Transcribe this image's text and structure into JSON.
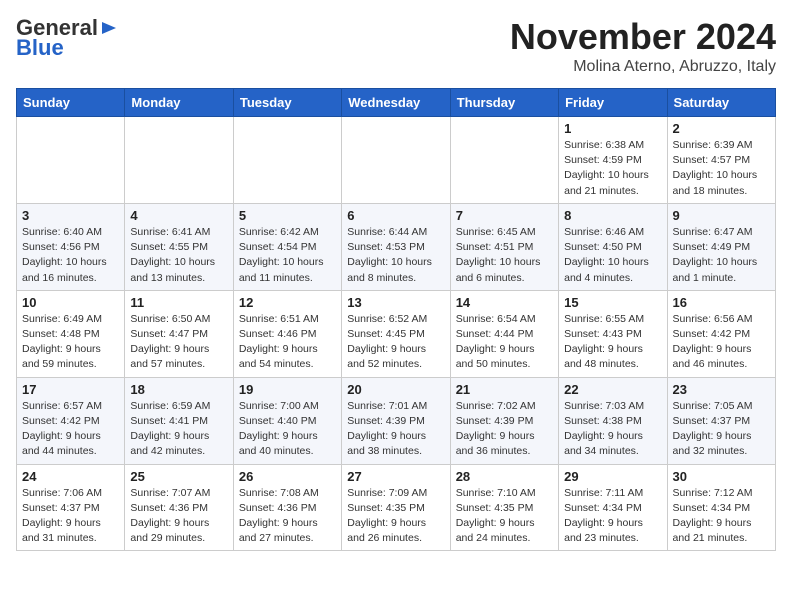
{
  "header": {
    "logo_general": "General",
    "logo_blue": "Blue",
    "month_title": "November 2024",
    "subtitle": "Molina Aterno, Abruzzo, Italy"
  },
  "weekdays": [
    "Sunday",
    "Monday",
    "Tuesday",
    "Wednesday",
    "Thursday",
    "Friday",
    "Saturday"
  ],
  "weeks": [
    [
      {
        "day": "",
        "info": ""
      },
      {
        "day": "",
        "info": ""
      },
      {
        "day": "",
        "info": ""
      },
      {
        "day": "",
        "info": ""
      },
      {
        "day": "",
        "info": ""
      },
      {
        "day": "1",
        "info": "Sunrise: 6:38 AM\nSunset: 4:59 PM\nDaylight: 10 hours and 21 minutes."
      },
      {
        "day": "2",
        "info": "Sunrise: 6:39 AM\nSunset: 4:57 PM\nDaylight: 10 hours and 18 minutes."
      }
    ],
    [
      {
        "day": "3",
        "info": "Sunrise: 6:40 AM\nSunset: 4:56 PM\nDaylight: 10 hours and 16 minutes."
      },
      {
        "day": "4",
        "info": "Sunrise: 6:41 AM\nSunset: 4:55 PM\nDaylight: 10 hours and 13 minutes."
      },
      {
        "day": "5",
        "info": "Sunrise: 6:42 AM\nSunset: 4:54 PM\nDaylight: 10 hours and 11 minutes."
      },
      {
        "day": "6",
        "info": "Sunrise: 6:44 AM\nSunset: 4:53 PM\nDaylight: 10 hours and 8 minutes."
      },
      {
        "day": "7",
        "info": "Sunrise: 6:45 AM\nSunset: 4:51 PM\nDaylight: 10 hours and 6 minutes."
      },
      {
        "day": "8",
        "info": "Sunrise: 6:46 AM\nSunset: 4:50 PM\nDaylight: 10 hours and 4 minutes."
      },
      {
        "day": "9",
        "info": "Sunrise: 6:47 AM\nSunset: 4:49 PM\nDaylight: 10 hours and 1 minute."
      }
    ],
    [
      {
        "day": "10",
        "info": "Sunrise: 6:49 AM\nSunset: 4:48 PM\nDaylight: 9 hours and 59 minutes."
      },
      {
        "day": "11",
        "info": "Sunrise: 6:50 AM\nSunset: 4:47 PM\nDaylight: 9 hours and 57 minutes."
      },
      {
        "day": "12",
        "info": "Sunrise: 6:51 AM\nSunset: 4:46 PM\nDaylight: 9 hours and 54 minutes."
      },
      {
        "day": "13",
        "info": "Sunrise: 6:52 AM\nSunset: 4:45 PM\nDaylight: 9 hours and 52 minutes."
      },
      {
        "day": "14",
        "info": "Sunrise: 6:54 AM\nSunset: 4:44 PM\nDaylight: 9 hours and 50 minutes."
      },
      {
        "day": "15",
        "info": "Sunrise: 6:55 AM\nSunset: 4:43 PM\nDaylight: 9 hours and 48 minutes."
      },
      {
        "day": "16",
        "info": "Sunrise: 6:56 AM\nSunset: 4:42 PM\nDaylight: 9 hours and 46 minutes."
      }
    ],
    [
      {
        "day": "17",
        "info": "Sunrise: 6:57 AM\nSunset: 4:42 PM\nDaylight: 9 hours and 44 minutes."
      },
      {
        "day": "18",
        "info": "Sunrise: 6:59 AM\nSunset: 4:41 PM\nDaylight: 9 hours and 42 minutes."
      },
      {
        "day": "19",
        "info": "Sunrise: 7:00 AM\nSunset: 4:40 PM\nDaylight: 9 hours and 40 minutes."
      },
      {
        "day": "20",
        "info": "Sunrise: 7:01 AM\nSunset: 4:39 PM\nDaylight: 9 hours and 38 minutes."
      },
      {
        "day": "21",
        "info": "Sunrise: 7:02 AM\nSunset: 4:39 PM\nDaylight: 9 hours and 36 minutes."
      },
      {
        "day": "22",
        "info": "Sunrise: 7:03 AM\nSunset: 4:38 PM\nDaylight: 9 hours and 34 minutes."
      },
      {
        "day": "23",
        "info": "Sunrise: 7:05 AM\nSunset: 4:37 PM\nDaylight: 9 hours and 32 minutes."
      }
    ],
    [
      {
        "day": "24",
        "info": "Sunrise: 7:06 AM\nSunset: 4:37 PM\nDaylight: 9 hours and 31 minutes."
      },
      {
        "day": "25",
        "info": "Sunrise: 7:07 AM\nSunset: 4:36 PM\nDaylight: 9 hours and 29 minutes."
      },
      {
        "day": "26",
        "info": "Sunrise: 7:08 AM\nSunset: 4:36 PM\nDaylight: 9 hours and 27 minutes."
      },
      {
        "day": "27",
        "info": "Sunrise: 7:09 AM\nSunset: 4:35 PM\nDaylight: 9 hours and 26 minutes."
      },
      {
        "day": "28",
        "info": "Sunrise: 7:10 AM\nSunset: 4:35 PM\nDaylight: 9 hours and 24 minutes."
      },
      {
        "day": "29",
        "info": "Sunrise: 7:11 AM\nSunset: 4:34 PM\nDaylight: 9 hours and 23 minutes."
      },
      {
        "day": "30",
        "info": "Sunrise: 7:12 AM\nSunset: 4:34 PM\nDaylight: 9 hours and 21 minutes."
      }
    ]
  ]
}
